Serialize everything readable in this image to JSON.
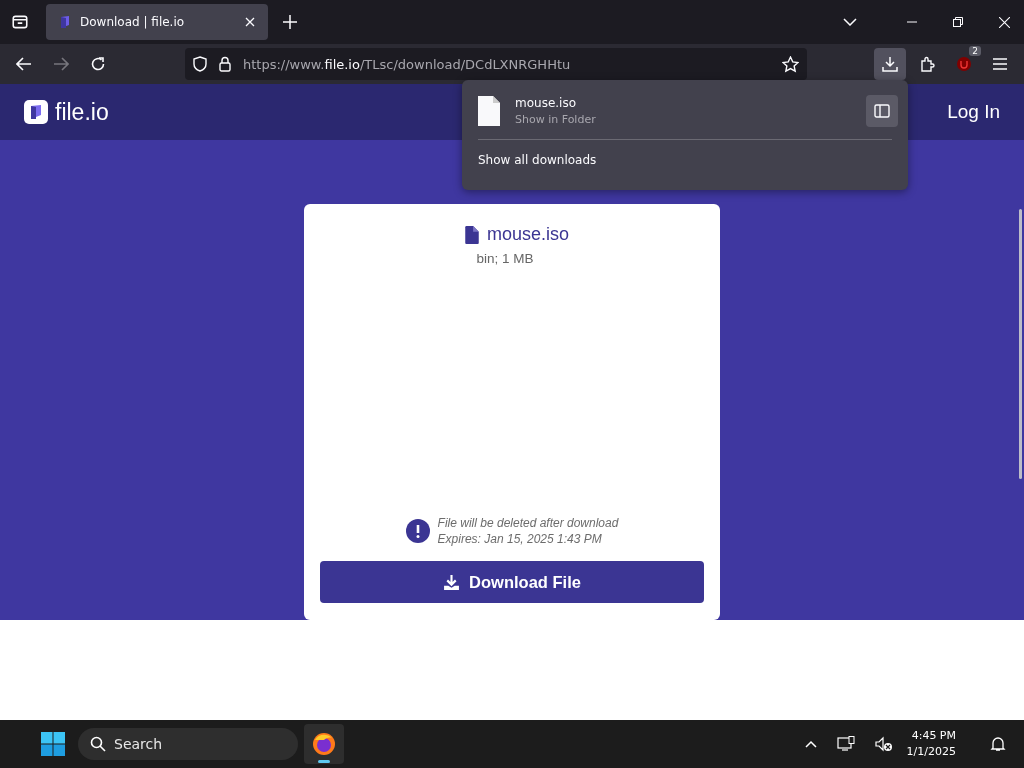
{
  "browser": {
    "tabs": [
      {
        "title": "Download | file.io",
        "selected": true
      }
    ],
    "url": {
      "scheme": "https://www.",
      "domain": "file.io",
      "path": "/TLsc/download/DCdLXNRGHHtu"
    },
    "extension_badge": "2"
  },
  "downloads_panel": {
    "items": [
      {
        "name": "mouse.iso",
        "status": "Show in Folder"
      }
    ],
    "footer": "Show all downloads"
  },
  "header": {
    "logo": "file.io",
    "nav_links": [
      "Log In"
    ]
  },
  "file_card": {
    "name": "mouse.iso",
    "meta": "bin; 1 MB",
    "notice": "File will be deleted after download",
    "expires": "Expires: Jan 15, 2025 1:43 PM",
    "button": "Download File"
  },
  "taskbar": {
    "search": {
      "placeholder": "Search"
    },
    "time": "4:45 PM",
    "date": "1/1/2025"
  }
}
